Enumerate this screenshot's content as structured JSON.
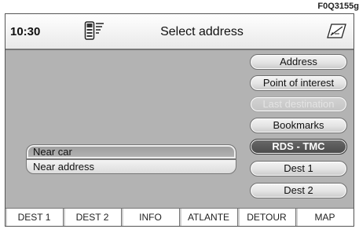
{
  "figure_code": "F0Q3155g",
  "header": {
    "time": "10:30",
    "title": "Select address"
  },
  "icons": {
    "phone": "phone-signal-icon",
    "edit": "edit-pen-icon"
  },
  "menu": {
    "address": "Address",
    "poi": "Point of interest",
    "last_destination": "Last destination",
    "bookmarks": "Bookmarks",
    "rds_tmc": "RDS - TMC",
    "dest1": "Dest 1",
    "dest2": "Dest 2"
  },
  "options": {
    "near_car": "Near car",
    "near_address": "Near address"
  },
  "bottom_bar": [
    "DEST 1",
    "DEST 2",
    "INFO",
    "ATLANTE",
    "DETOUR",
    "MAP"
  ]
}
